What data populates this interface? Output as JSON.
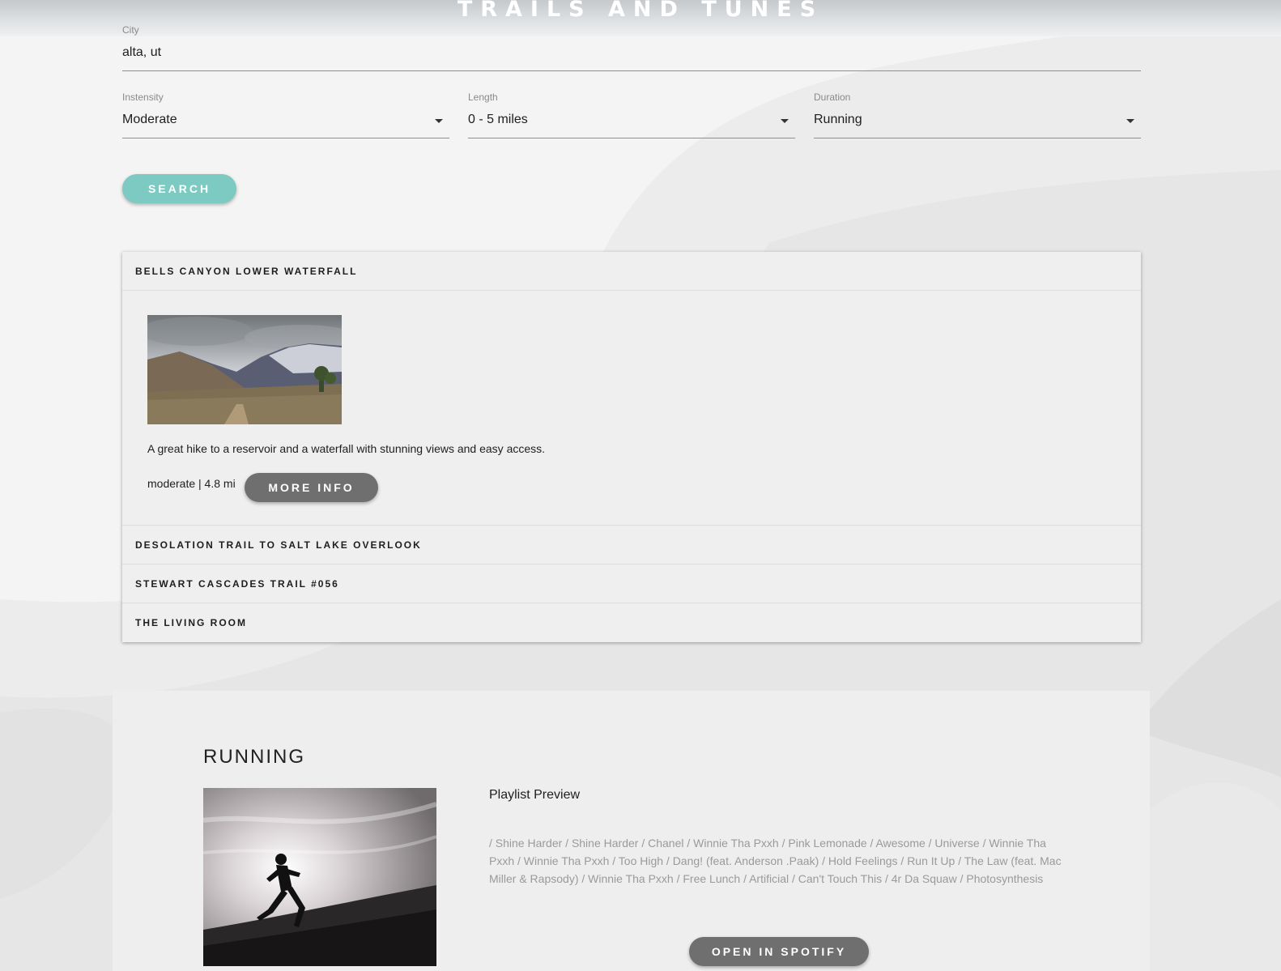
{
  "header": {
    "title": "TRAILS AND TUNES"
  },
  "form": {
    "city": {
      "label": "City",
      "value": "alta, ut"
    },
    "intensity": {
      "label": "Instensity",
      "value": "Moderate"
    },
    "length": {
      "label": "Length",
      "value": "0 - 5 miles"
    },
    "duration": {
      "label": "Duration",
      "value": "Running"
    },
    "search_label": "SEARCH"
  },
  "trails": {
    "items": [
      {
        "name": "BELLS CANYON LOWER WATERFALL",
        "description": "A great hike to a reservoir and a waterfall with stunning views and easy access.",
        "meta": "moderate | 4.8 mi",
        "more_info_label": "MORE INFO"
      },
      {
        "name": "DESOLATION TRAIL TO SALT LAKE OVERLOOK"
      },
      {
        "name": "STEWART CASCADES TRAIL #056"
      },
      {
        "name": "THE LIVING ROOM"
      }
    ]
  },
  "playlist": {
    "title": "RUNNING",
    "preview_label": "Playlist Preview",
    "tracks_text": "/ Shine Harder / Shine Harder / Chanel / Winnie Tha Pxxh / Pink Lemonade / Awesome / Universe / Winnie Tha Pxxh / Winnie Tha Pxxh / Too High / Dang! (feat. Anderson .Paak) / Hold Feelings / Run It Up / The Law (feat. Mac Miller & Rapsody) / Winnie Tha Pxxh / Free Lunch / Artificial / Can't Touch This / 4r Da Squaw / Photosynthesis",
    "spotify_label": "OPEN IN SPOTIFY"
  },
  "colors": {
    "accent_search": "#7ccac2",
    "button_dark": "#6f6f6f",
    "background": "#f3f3f3"
  }
}
